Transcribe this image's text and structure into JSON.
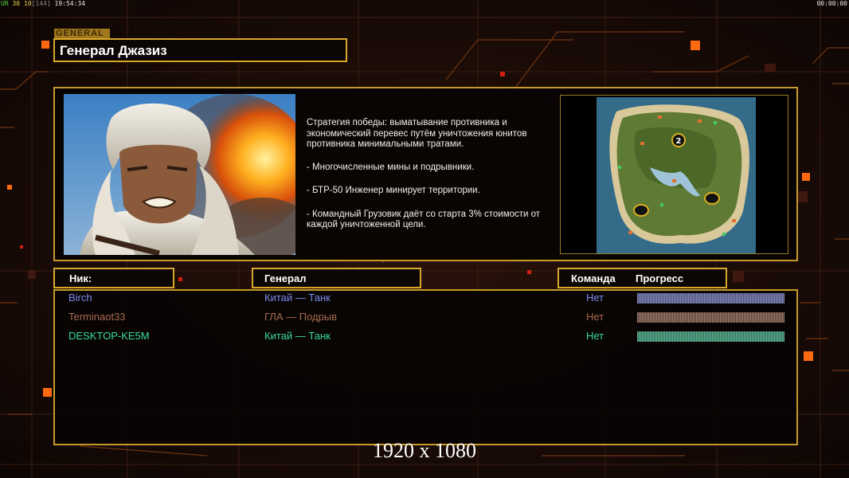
{
  "hud": {
    "fps_label": "UR",
    "fps_values": [
      "30",
      "10"
    ],
    "fps_extra": "[144]",
    "clock": "19:54:34",
    "timer": "00:00:00"
  },
  "screen": {
    "section_tag": "GENERAL",
    "general_name": "Генерал Джазиз",
    "description": [
      "Стратегия победы: выматывание противника и экономический перевес путём уничтожения юнитов противника минимальными тратами.",
      "- Многочисленные мины и подрывники.",
      "- БТР-50 Инженер минирует территории.",
      "- Командный Грузовик даёт со старта 3% стоимости от каждой уничтоженной цели."
    ],
    "map_start_marker": "2",
    "resolution_label": "1920 x 1080"
  },
  "table": {
    "headers": {
      "nick": "Ник:",
      "general": "Генерал",
      "team": "Команда",
      "progress": "Прогресс"
    },
    "players": [
      {
        "nick": "Birch",
        "general": "Китай — Танк",
        "team": "Нет",
        "color": "#7b8cf0",
        "progress": 1.0
      },
      {
        "nick": "Terminaot33",
        "general": "ГЛА — Подрыв",
        "team": "Нет",
        "color": "#a86a52",
        "progress": 1.0
      },
      {
        "nick": "DESKTOP-KE5M",
        "general": "Китай — Танк",
        "team": "Нет",
        "color": "#38dba0",
        "progress": 1.0
      }
    ]
  }
}
